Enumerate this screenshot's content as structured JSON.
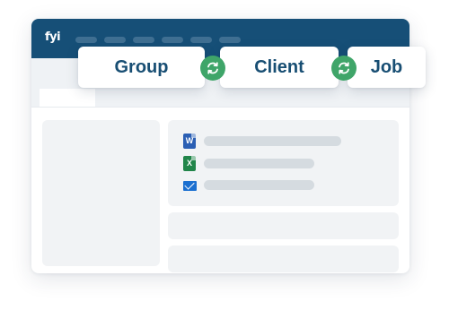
{
  "app": {
    "logo_text": "fyi"
  },
  "header": {
    "tabs": [
      "",
      "",
      "",
      "",
      "",
      ""
    ]
  },
  "cards": [
    {
      "label": "Group"
    },
    {
      "label": "Client"
    },
    {
      "label": "Job"
    }
  ],
  "documents": [
    {
      "type": "word",
      "icon": "word-document-icon",
      "icon_letter": "W"
    },
    {
      "type": "excel",
      "icon": "excel-spreadsheet-icon",
      "icon_letter": "X"
    },
    {
      "type": "email",
      "icon": "email-icon",
      "icon_letter": ""
    }
  ],
  "colors": {
    "titlebar": "#164f77",
    "accent_green": "#3fa569",
    "card_text": "#184e73",
    "word": "#2b5fb4",
    "excel": "#21854a",
    "email": "#1b6fd0"
  }
}
